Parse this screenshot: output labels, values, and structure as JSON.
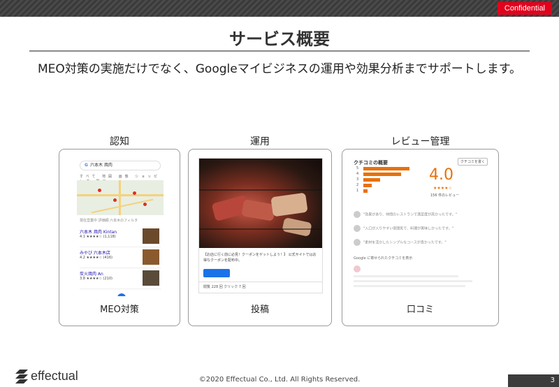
{
  "header": {
    "confidential": "Confidential"
  },
  "title": "サービス概要",
  "subtitle": "MEO対策の実施だけでなく、Googleマイビジネスの運用や効果分析までサポートします。",
  "columns": [
    {
      "category": "認知",
      "caption": "MEO対策"
    },
    {
      "category": "運用",
      "caption": "投稿"
    },
    {
      "category": "レビュー管理",
      "caption": "口コミ"
    }
  ],
  "mock": {
    "search_query": "六本木 焼肉",
    "tabs": "すべて 地図 画像 ショッピング 動画",
    "chips": "現在営業中  評価順  六本木のフィルタ",
    "items": [
      {
        "name": "六本木 焼肉 Kintan",
        "detail": "4.1 ★★★★☆ (1,118)"
      },
      {
        "name": "みやび 六本木店",
        "detail": "4.2 ★★★★☆ (416)"
      },
      {
        "name": "炭火焼肉 An",
        "detail": "3.8 ★★★★☆ (210)"
      }
    ],
    "post_text": "【お店に行く前に必見！クーポンをゲットしよう！】 公式サイトではお得なクーポンを配布中。",
    "post_footer": "閲覧 228 回   クリック 7 回",
    "review_head": "クチコミの概要",
    "review_button": "クチコミを書く",
    "review_score": "4.0",
    "review_stars": "★★★★☆",
    "review_count": "156 件のレビュー",
    "review_nums": [
      "5",
      "4",
      "3",
      "2",
      "1"
    ],
    "review_bars": [
      0.55,
      0.45,
      0.2,
      0.1,
      0.05
    ],
    "review_lines": [
      "\"効果があり、仲間のレストランで満足度が高かったです。\"",
      "\"入口が入りやすい雰囲気で、料理が美味しかったです。\"",
      "\"素材を活かしたシンプルなコースが良かったです。\"",
      "Google に寄せられたクチコミを表示"
    ]
  },
  "footer": {
    "logo": "effectual",
    "copyright": "©2020 Effectual Co., Ltd. All Rights Reserved.",
    "page": "3"
  }
}
